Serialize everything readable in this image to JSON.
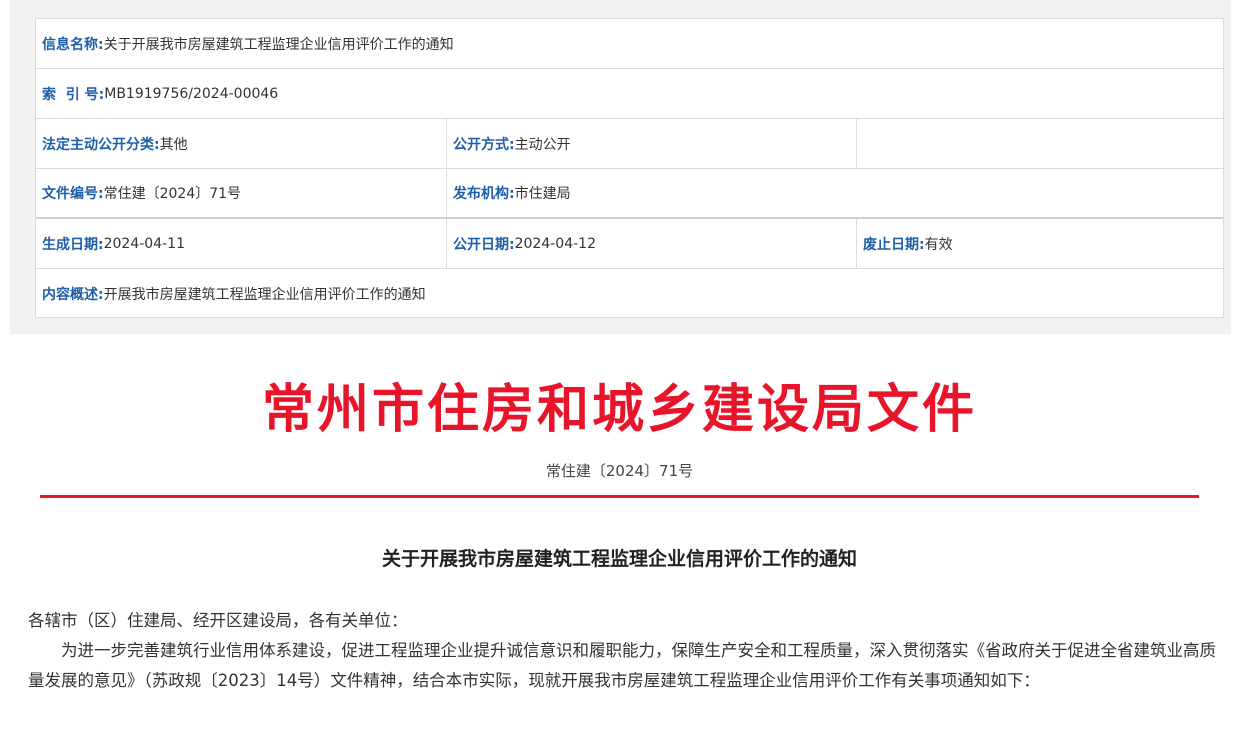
{
  "info": {
    "name_label": "信息名称:",
    "name_value": "关于开展我市房屋建筑工程监理企业信用评价工作的通知",
    "index_label": "索  引 号:",
    "index_value": "MB1919756/2024-00046",
    "category_label": "法定主动公开分类:",
    "category_value": "其他",
    "method_label": "公开方式:",
    "method_value": "主动公开",
    "docno_label": "文件编号:",
    "docno_value": "常住建〔2024〕71号",
    "publisher_label": "发布机构:",
    "publisher_value": "市住建局",
    "created_label": "生成日期:",
    "created_value": "2024-04-11",
    "published_label": "公开日期:",
    "published_value": "2024-04-12",
    "expiry_label": "废止日期:",
    "expiry_value": "有效",
    "summary_label": "内容概述:",
    "summary_value": "开展我市房屋建筑工程监理企业信用评价工作的通知"
  },
  "document": {
    "red_header": "常州市住房和城乡建设局文件",
    "doc_number": "常住建〔2024〕71号",
    "title": "关于开展我市房屋建筑工程监理企业信用评价工作的通知",
    "salutation": "各辖市（区）住建局、经开区建设局，各有关单位：",
    "paragraph_1": "为进一步完善建筑行业信用体系建设，促进工程监理企业提升诚信意识和履职能力，保障生产安全和工程质量，深入贯彻落实《省政府关于促进全省建筑业高质量发展的意见》（苏政规〔2023〕14号）文件精神，结合本市实际，现就开展我市房屋建筑工程监理企业信用评价工作有关事项通知如下："
  },
  "colors": {
    "label_blue": "#1f5ea8",
    "header_red": "#e8142a"
  }
}
